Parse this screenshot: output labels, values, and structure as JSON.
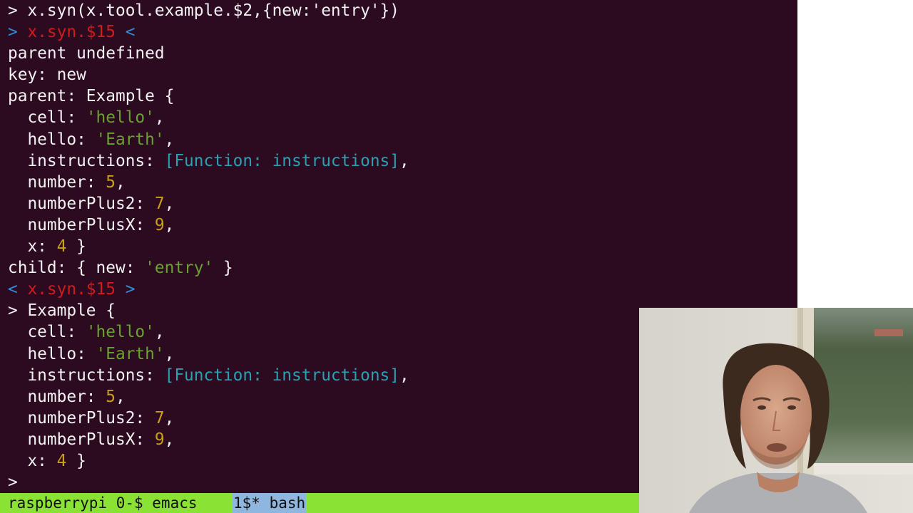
{
  "terminal": {
    "lines": [
      [
        {
          "t": "> x.syn(x.tool.example.$2,{new:'entry'})",
          "c": "default"
        }
      ],
      [
        {
          "t": "> ",
          "c": "prompt"
        },
        {
          "t": "x.syn.$15",
          "c": "red"
        },
        {
          "t": " <",
          "c": "prompt"
        }
      ],
      [
        {
          "t": "parent undefined",
          "c": "default"
        }
      ],
      [
        {
          "t": "key: new",
          "c": "default"
        }
      ],
      [
        {
          "t": "parent: Example {",
          "c": "default"
        }
      ],
      [
        {
          "t": "  cell: ",
          "c": "default"
        },
        {
          "t": "'hello'",
          "c": "string"
        },
        {
          "t": ",",
          "c": "default"
        }
      ],
      [
        {
          "t": "  hello: ",
          "c": "default"
        },
        {
          "t": "'Earth'",
          "c": "string"
        },
        {
          "t": ",",
          "c": "default"
        }
      ],
      [
        {
          "t": "  instructions: ",
          "c": "default"
        },
        {
          "t": "[Function: instructions]",
          "c": "func"
        },
        {
          "t": ",",
          "c": "default"
        }
      ],
      [
        {
          "t": "  number: ",
          "c": "default"
        },
        {
          "t": "5",
          "c": "number"
        },
        {
          "t": ",",
          "c": "default"
        }
      ],
      [
        {
          "t": "  numberPlus2: ",
          "c": "default"
        },
        {
          "t": "7",
          "c": "number"
        },
        {
          "t": ",",
          "c": "default"
        }
      ],
      [
        {
          "t": "  numberPlusX: ",
          "c": "default"
        },
        {
          "t": "9",
          "c": "number"
        },
        {
          "t": ",",
          "c": "default"
        }
      ],
      [
        {
          "t": "  x: ",
          "c": "default"
        },
        {
          "t": "4",
          "c": "number"
        },
        {
          "t": " }",
          "c": "default"
        }
      ],
      [
        {
          "t": "child: { new: ",
          "c": "default"
        },
        {
          "t": "'entry'",
          "c": "string"
        },
        {
          "t": " }",
          "c": "default"
        }
      ],
      [
        {
          "t": "< ",
          "c": "prompt"
        },
        {
          "t": "x.syn.$15",
          "c": "red"
        },
        {
          "t": " >",
          "c": "prompt"
        }
      ],
      [
        {
          "t": "> Example {",
          "c": "default"
        }
      ],
      [
        {
          "t": "  cell: ",
          "c": "default"
        },
        {
          "t": "'hello'",
          "c": "string"
        },
        {
          "t": ",",
          "c": "default"
        }
      ],
      [
        {
          "t": "  hello: ",
          "c": "default"
        },
        {
          "t": "'Earth'",
          "c": "string"
        },
        {
          "t": ",",
          "c": "default"
        }
      ],
      [
        {
          "t": "  instructions: ",
          "c": "default"
        },
        {
          "t": "[Function: instructions]",
          "c": "func"
        },
        {
          "t": ",",
          "c": "default"
        }
      ],
      [
        {
          "t": "  number: ",
          "c": "default"
        },
        {
          "t": "5",
          "c": "number"
        },
        {
          "t": ",",
          "c": "default"
        }
      ],
      [
        {
          "t": "  numberPlus2: ",
          "c": "default"
        },
        {
          "t": "7",
          "c": "number"
        },
        {
          "t": ",",
          "c": "default"
        }
      ],
      [
        {
          "t": "  numberPlusX: ",
          "c": "default"
        },
        {
          "t": "9",
          "c": "number"
        },
        {
          "t": ",",
          "c": "default"
        }
      ],
      [
        {
          "t": "  x: ",
          "c": "default"
        },
        {
          "t": "4",
          "c": "number"
        },
        {
          "t": " }",
          "c": "default"
        }
      ],
      [
        {
          "t": ">",
          "c": "default"
        }
      ]
    ]
  },
  "status_bar": {
    "session": "raspberrypi 0-$ emacs",
    "active_window": "1$* bash"
  },
  "colors": {
    "terminal_background": "#2c0a20",
    "default_text": "#f2f2f2",
    "string": "#6aa230",
    "number": "#c8a016",
    "function": "#2aa1b3",
    "red_identifier": "#d11c1c",
    "prompt_arrow": "#2e8fd8",
    "status_bar": "#8ae234",
    "status_active_window": "#8eb6de"
  },
  "webcam": {
    "icon": "presenter-video"
  }
}
